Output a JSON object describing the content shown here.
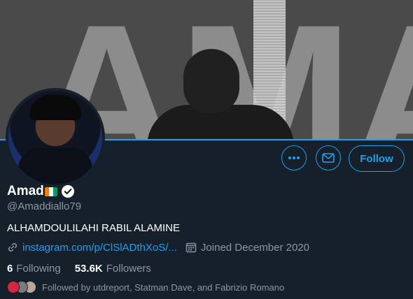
{
  "banner": {
    "text": "AMAD"
  },
  "profile": {
    "name": "Amad",
    "handle": "@Amaddiallo79",
    "bio": "ALHAMDOULILAHI RABIL ALAMINE",
    "link": "instagram.com/p/ClSlADthXoS/...",
    "joined": "Joined December 2020",
    "flag_colors": [
      "#f77f00",
      "#ffffff",
      "#009e60"
    ]
  },
  "actions": {
    "more_icon": "more-icon",
    "message_icon": "mail-icon",
    "follow_label": "Follow"
  },
  "stats": {
    "following_count": "6",
    "following_label": "Following",
    "followers_count": "53.6K",
    "followers_label": "Followers"
  },
  "followed_by": {
    "text": "Followed by utdreport, Statman Dave, and Fabrizio Romano"
  },
  "colors": {
    "background": "#15202b",
    "accent": "#1da1f2",
    "secondary_text": "#8899a6"
  }
}
